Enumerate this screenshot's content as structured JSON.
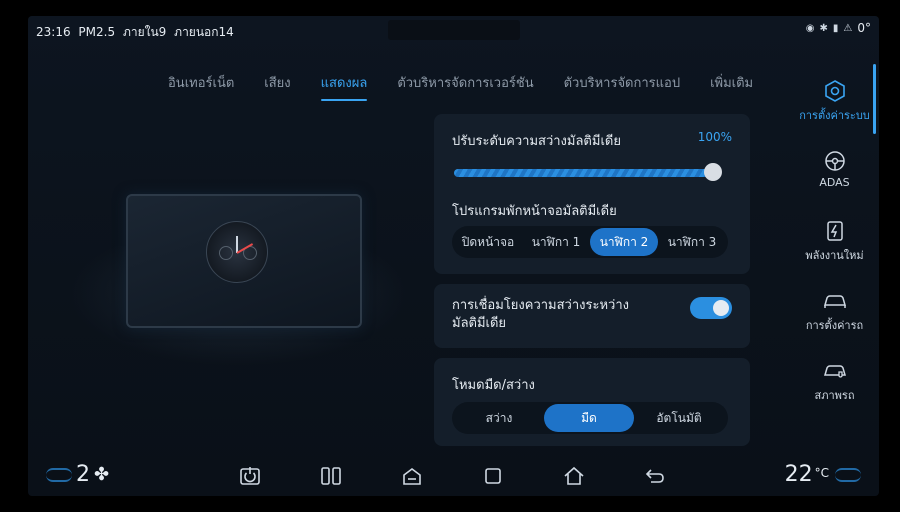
{
  "status": {
    "time": "23:16",
    "pm": "PM2.5",
    "inside": "ภายใน9",
    "outside": "ภายนอก14",
    "outside_temp": "0°"
  },
  "tabs": [
    {
      "label": "อินเทอร์เน็ต"
    },
    {
      "label": "เสียง"
    },
    {
      "label": "แสดงผล",
      "active": true
    },
    {
      "label": "ตัวบริหารจัดการเวอร์ชัน"
    },
    {
      "label": "ตัวบริหารจัดการแอป"
    },
    {
      "label": "เพิ่มเติม"
    }
  ],
  "sidebar": {
    "items": [
      {
        "label": "การตั้งค่าระบบ",
        "icon": "system-settings-icon",
        "active": true
      },
      {
        "label": "ADAS",
        "icon": "steering-wheel-icon"
      },
      {
        "label": "พลังงานใหม่",
        "icon": "energy-icon"
      },
      {
        "label": "การตั้งค่ารถ",
        "icon": "car-icon"
      },
      {
        "label": "สภาพรถ",
        "icon": "car-status-icon"
      }
    ]
  },
  "media_brightness": {
    "title": "ปรับระดับความสว่างมัลติมีเดีย",
    "value": "100%",
    "level": 1.0
  },
  "screensaver": {
    "title": "โปรแกรมพักหน้าจอมัลติมีเดีย",
    "options": [
      "ปิดหน้าจอ",
      "นาฬิกา 1",
      "นาฬิกา 2",
      "นาฬิกา 3"
    ],
    "selected": "นาฬิกา 2"
  },
  "brightness_link": {
    "title_line1": "การเชื่อมโยงความสว่างระหว่าง",
    "title_line2": "มัลติมีเดีย",
    "enabled": true
  },
  "dark_mode": {
    "title": "โหมดมืด/สว่าง",
    "options": [
      "สว่าง",
      "มืด",
      "อัตโนมัติ"
    ],
    "selected": "มืด"
  },
  "bottom": {
    "fan_level": "2",
    "temperature": "22",
    "temp_unit": "°C"
  },
  "colors": {
    "accent": "#3aa4f2",
    "background": "#0c141d",
    "card": "#141e2a"
  }
}
